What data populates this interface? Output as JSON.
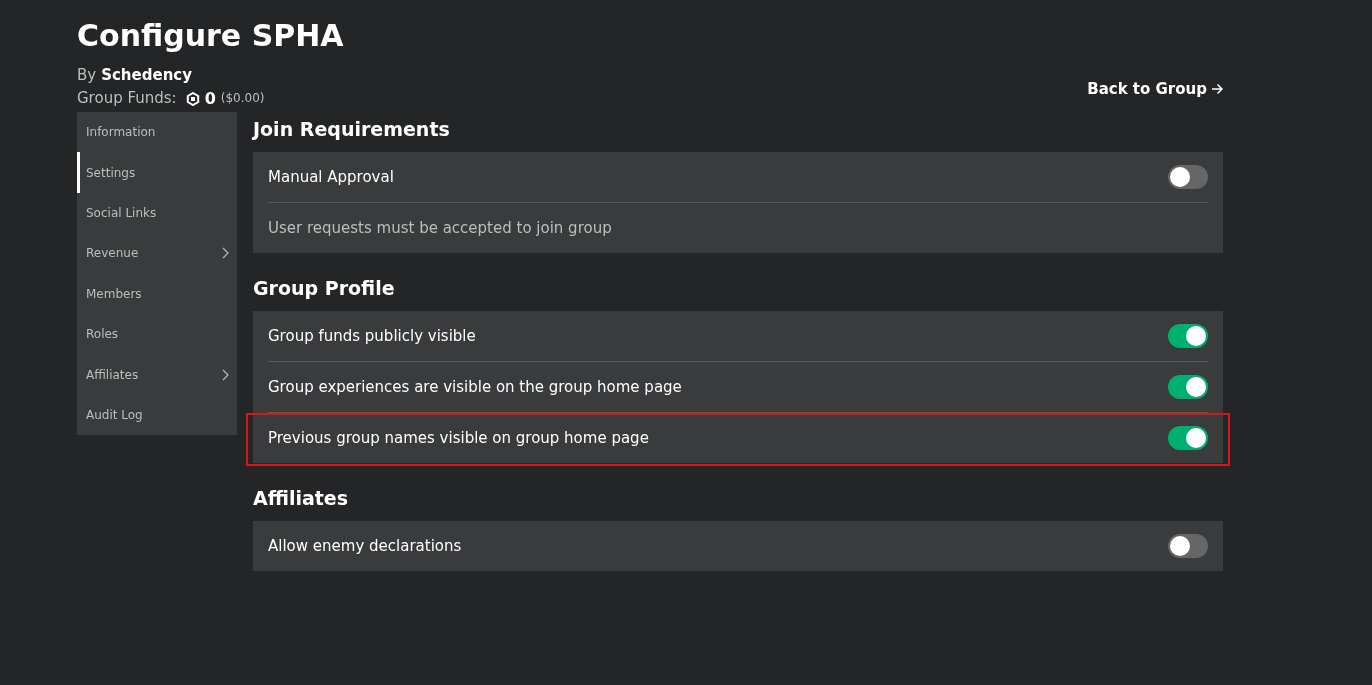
{
  "header": {
    "title": "Configure SPHA",
    "by_label": "By",
    "owner": "Schedency",
    "funds_label": "Group Funds:",
    "funds_amount": "0",
    "funds_usd": "($0.00)",
    "back_link": "Back to Group"
  },
  "sidebar": {
    "items": [
      {
        "label": "Information",
        "selected": false,
        "submenu": false
      },
      {
        "label": "Settings",
        "selected": true,
        "submenu": false
      },
      {
        "label": "Social Links",
        "selected": false,
        "submenu": false
      },
      {
        "label": "Revenue",
        "selected": false,
        "submenu": true
      },
      {
        "label": "Members",
        "selected": false,
        "submenu": false
      },
      {
        "label": "Roles",
        "selected": false,
        "submenu": false
      },
      {
        "label": "Affiliates",
        "selected": false,
        "submenu": true
      },
      {
        "label": "Audit Log",
        "selected": false,
        "submenu": false
      }
    ]
  },
  "sections": [
    {
      "title": "Join Requirements",
      "rows": [
        {
          "kind": "toggle",
          "label": "Manual Approval",
          "on": false,
          "highlighted": false
        },
        {
          "kind": "note",
          "text": "User requests must be accepted to join group"
        }
      ]
    },
    {
      "title": "Group Profile",
      "rows": [
        {
          "kind": "toggle",
          "label": "Group funds publicly visible",
          "on": true,
          "highlighted": false
        },
        {
          "kind": "toggle",
          "label": "Group experiences are visible on the group home page",
          "on": true,
          "highlighted": false
        },
        {
          "kind": "toggle",
          "label": "Previous group names visible on group home page",
          "on": true,
          "highlighted": true
        }
      ]
    },
    {
      "title": "Affiliates",
      "rows": [
        {
          "kind": "toggle",
          "label": "Allow enemy declarations",
          "on": false,
          "highlighted": false
        }
      ]
    }
  ]
}
